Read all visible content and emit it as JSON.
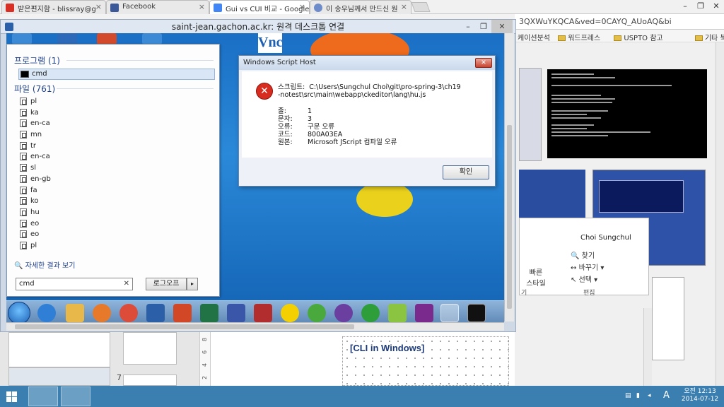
{
  "browser": {
    "tabs": [
      {
        "label": "받은편지함 - blissray@g",
        "icon_color": "#d93025",
        "active": false
      },
      {
        "label": "Facebook",
        "icon_color": "#3b5998",
        "active": false
      },
      {
        "label": "Gui vs CUI 비교 - Google",
        "icon_color": "#4285f4",
        "active": true
      },
      {
        "label": "이 송우님께서 만드신 원",
        "icon_color": "#6e8cc9",
        "active": false
      }
    ],
    "url_fragment": "3QXWuYKQCA&ved=0CAYQ_AUoAQ&bi",
    "bookmarks": [
      "케이션분석",
      "워드프레스",
      "USPTO 참고",
      "기타 북마크"
    ]
  },
  "remote_desktop": {
    "title": "saint-jean.gachon.ac.kr: 원격 데스크톱 연결",
    "vnc_logo": "Vnc"
  },
  "start_menu": {
    "programs_header": "프로그램 (1)",
    "program_item": "cmd",
    "files_header": "파일 (761)",
    "files": [
      "pl",
      "ka",
      "en-ca",
      "mn",
      "tr",
      "en-ca",
      "sl",
      "en-gb",
      "fa",
      "ko",
      "hu",
      "eo",
      "eo",
      "pl"
    ],
    "see_more": "자세한 결과 보기",
    "search_value": "cmd",
    "logoff_label": "로그오프",
    "arrow": "▸"
  },
  "dialog": {
    "title": "Windows Script Host",
    "script_label": "스크립트:",
    "script_path": "C:\\Users\\Sungchul Choi\\git\\pro-spring-3\\ch19-notest\\src\\main\\webapp\\ckeditor\\lang\\hu.js",
    "line_label": "줄:",
    "line_value": "1",
    "char_label": "문자:",
    "char_value": "3",
    "error_label": "오류:",
    "error_value": "구문 오류",
    "code_label": "코드:",
    "code_value": "800A03EA",
    "source_label": "원본:",
    "source_value": "Microsoft JScript 컴파일 오류",
    "ok_label": "확인"
  },
  "word_pane": {
    "user": "Choi Sungchul",
    "find": "찾기",
    "replace": "바꾸기",
    "select": "선택",
    "style_label": "빠른 스타일",
    "group": "편집",
    "style_group_fragment": "기"
  },
  "document": {
    "slide_caption": "[CLI in Windows]",
    "slide_number": "7",
    "ruler_numbers": [
      "8",
      "6",
      "4",
      "2"
    ]
  },
  "tray": {
    "time": "오전 12:13",
    "date": "2014-07-12",
    "ime": "A"
  },
  "colors": {
    "desktop_blue": "#1a6fc4",
    "error_red": "#d62d20",
    "host_taskbar": "#3a7fb0"
  }
}
